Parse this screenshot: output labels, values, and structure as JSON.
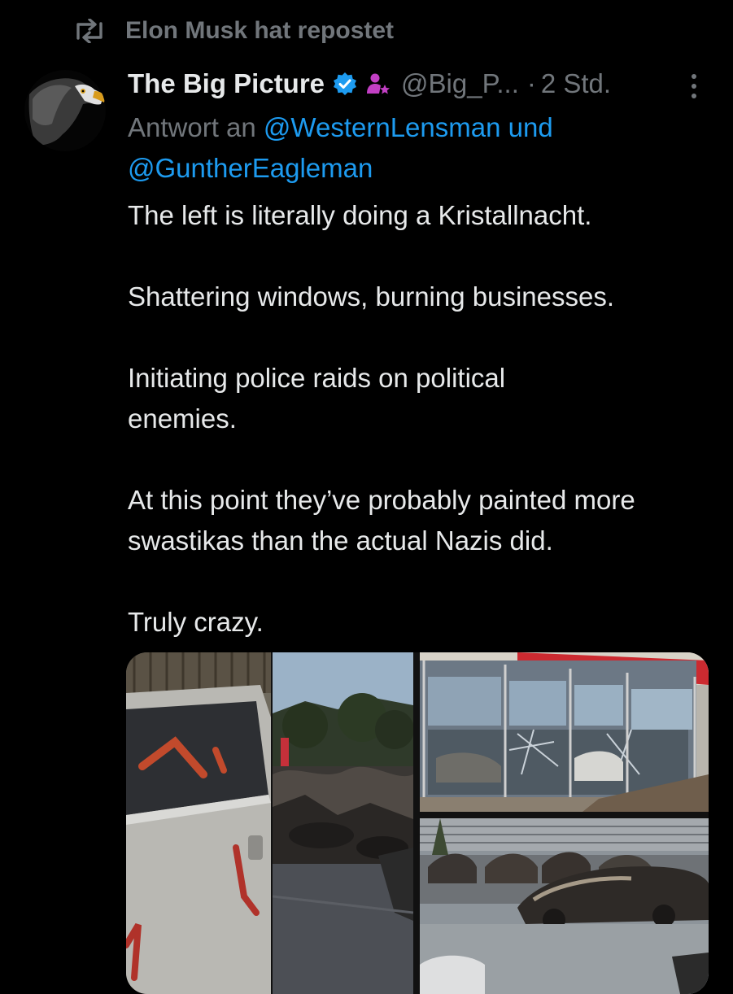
{
  "repost": {
    "label": "Elon Musk hat repostet",
    "icon": "repost-icon"
  },
  "tweet": {
    "display_name": "The Big Picture",
    "verified": true,
    "handle": "@Big_P...",
    "separator": "·",
    "time": "2 Std.",
    "reply_prefix": "Antwort an",
    "reply_mention_1": "@WesternLensman und",
    "reply_mention_2": "@GuntherEagleman",
    "paragraphs": [
      "The left is literally doing a Kristallnacht.",
      "Shattering windows, burning businesses.",
      "Initiating police raids on political enemies.",
      "At this point they’ve probably painted more swastikas than the actual Nazis did.",
      "Truly crazy."
    ]
  },
  "colors": {
    "background": "#000000",
    "text": "#e7e9ea",
    "secondary": "#71767b",
    "link": "#1d9bf0",
    "verified": "#1d9bf0",
    "affiliate": "#c23fc4"
  }
}
